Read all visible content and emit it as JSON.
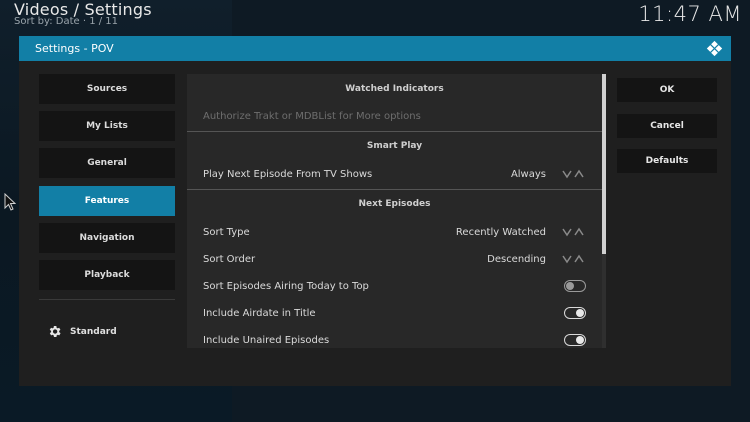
{
  "header": {
    "title": "Videos / Settings",
    "subtitle": "Sort by: Date  ·  1 / 11",
    "clock": "11:47 AM"
  },
  "dialog": {
    "title": "Settings - POV",
    "categories": [
      {
        "label": "Sources",
        "active": false
      },
      {
        "label": "My Lists",
        "active": false
      },
      {
        "label": "General",
        "active": false
      },
      {
        "label": "Features",
        "active": true
      },
      {
        "label": "Navigation",
        "active": false
      },
      {
        "label": "Playback",
        "active": false
      }
    ],
    "level_label": "Standard",
    "groups": {
      "watched": "Watched Indicators",
      "smart_play": "Smart Play",
      "next_episodes": "Next Episodes"
    },
    "settings": {
      "authorize": {
        "label": "Authorize Trakt or MDBList for More options"
      },
      "play_next": {
        "label": "Play Next Episode From TV Shows",
        "value": "Always"
      },
      "sort_type": {
        "label": "Sort Type",
        "value": "Recently Watched"
      },
      "sort_order": {
        "label": "Sort Order",
        "value": "Descending"
      },
      "sort_airing": {
        "label": "Sort Episodes Airing Today to Top",
        "enabled": false
      },
      "include_airdate": {
        "label": "Include Airdate in Title",
        "enabled": true
      },
      "include_unaired": {
        "label": "Include Unaired Episodes",
        "enabled": true
      }
    },
    "buttons": {
      "ok": "OK",
      "cancel": "Cancel",
      "defaults": "Defaults"
    }
  },
  "colors": {
    "accent": "#127fa6",
    "dialog_bg": "#1f1f1f",
    "list_bg": "#282828"
  }
}
